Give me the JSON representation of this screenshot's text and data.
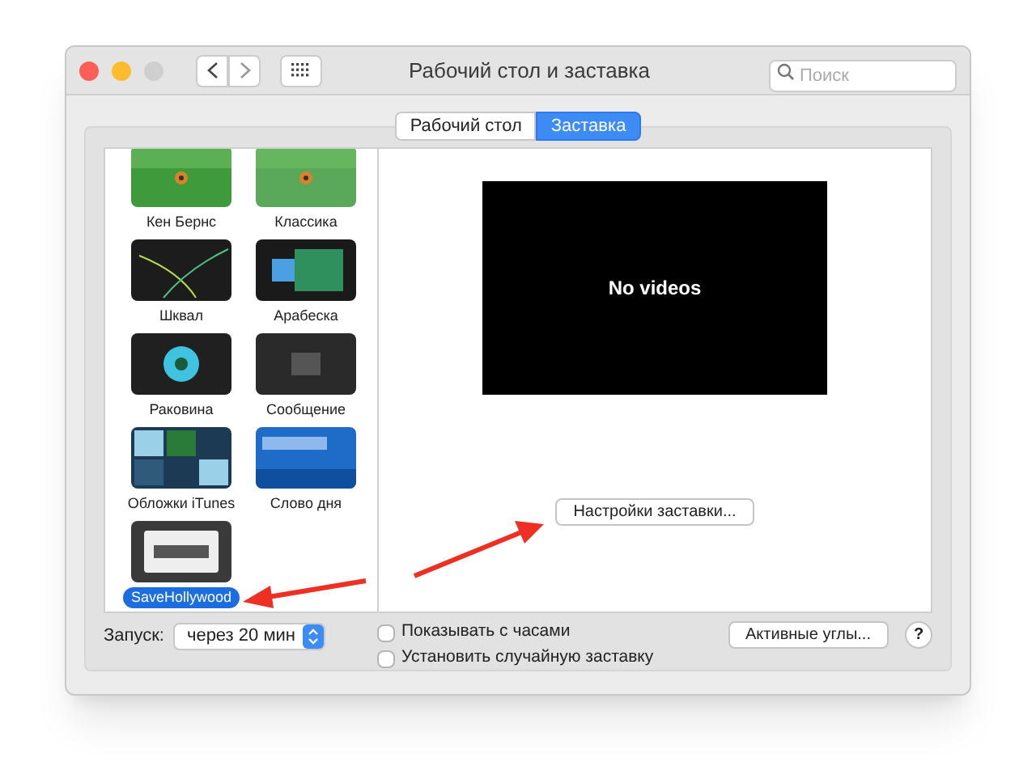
{
  "window": {
    "title": "Рабочий стол и заставка"
  },
  "search": {
    "placeholder": "Поиск"
  },
  "tabs": [
    {
      "label": "Рабочий стол",
      "selected": false
    },
    {
      "label": "Заставка",
      "selected": true
    }
  ],
  "screensavers": [
    {
      "name": "Кен Бернс",
      "selected": false
    },
    {
      "name": "Классика",
      "selected": false
    },
    {
      "name": "Шквал",
      "selected": false
    },
    {
      "name": "Арабеска",
      "selected": false
    },
    {
      "name": "Раковина",
      "selected": false
    },
    {
      "name": "Сообщение",
      "selected": false
    },
    {
      "name": "Обложки iTunes",
      "selected": false
    },
    {
      "name": "Слово дня",
      "selected": false
    },
    {
      "name": "SaveHollywood",
      "selected": true
    }
  ],
  "preview": {
    "message": "No videos"
  },
  "options_button": "Настройки заставки...",
  "start": {
    "label": "Запуск:",
    "value": "через 20 мин"
  },
  "checkboxes": [
    {
      "label": "Показывать с часами",
      "checked": false
    },
    {
      "label": "Установить случайную заставку",
      "checked": false
    }
  ],
  "hot_corners_button": "Активные углы...",
  "help_button": "?"
}
